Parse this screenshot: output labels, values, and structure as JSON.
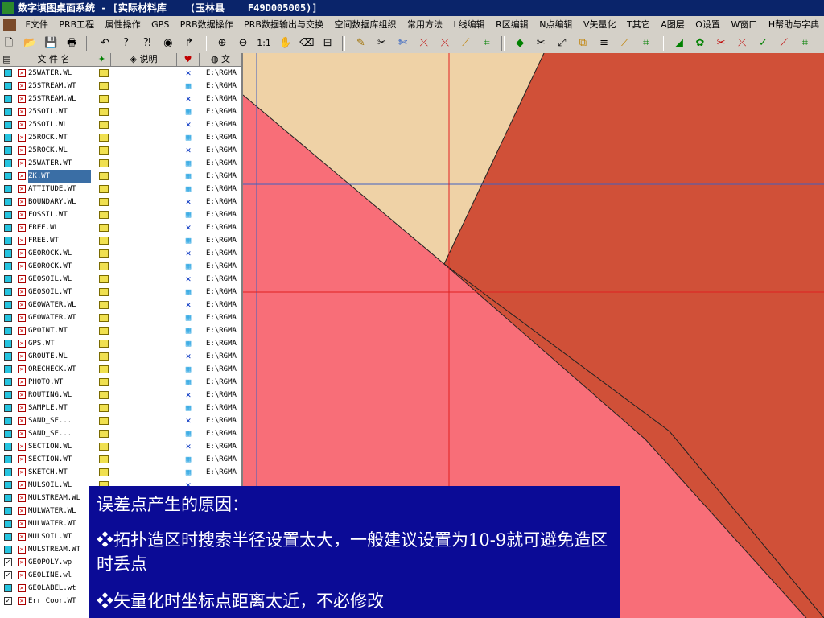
{
  "window": {
    "title": "数字填图桌面系统 - [实际材料库    (玉林县    F49D005005)]"
  },
  "menu": [
    {
      "label": "F文件"
    },
    {
      "label": "PRB工程"
    },
    {
      "label": "属性操作"
    },
    {
      "label": "GPS"
    },
    {
      "label": "PRB数据操作"
    },
    {
      "label": "PRB数据输出与交换"
    },
    {
      "label": "空间数据库组织"
    },
    {
      "label": "常用方法"
    },
    {
      "label": "L线编辑"
    },
    {
      "label": "R区编辑"
    },
    {
      "label": "N点编辑"
    },
    {
      "label": "V矢量化"
    },
    {
      "label": "T其它"
    },
    {
      "label": "A图层"
    },
    {
      "label": "O设置"
    },
    {
      "label": "W窗口"
    },
    {
      "label": "H帮助与字典"
    }
  ],
  "toolbar": {
    "zoom_label": "1:1"
  },
  "filelist": {
    "headers": {
      "name": "文 件 名",
      "desc": "说明",
      "path": "文"
    },
    "rows": [
      {
        "name": "25WATER.WL",
        "path": "E:\\RGMA",
        "checked": false,
        "type": "line"
      },
      {
        "name": "25STREAM.WT",
        "path": "E:\\RGMA",
        "checked": false,
        "type": "point"
      },
      {
        "name": "25STREAM.WL",
        "path": "E:\\RGMA",
        "checked": false,
        "type": "line"
      },
      {
        "name": "25SOIL.WT",
        "path": "E:\\RGMA",
        "checked": false,
        "type": "point"
      },
      {
        "name": "25SOIL.WL",
        "path": "E:\\RGMA",
        "checked": false,
        "type": "line"
      },
      {
        "name": "25ROCK.WT",
        "path": "E:\\RGMA",
        "checked": false,
        "type": "point"
      },
      {
        "name": "25ROCK.WL",
        "path": "E:\\RGMA",
        "checked": false,
        "type": "line"
      },
      {
        "name": "25WATER.WT",
        "path": "E:\\RGMA",
        "checked": false,
        "type": "point"
      },
      {
        "name": "ZK.WT",
        "path": "E:\\RGMA",
        "checked": false,
        "type": "point",
        "selected": true
      },
      {
        "name": "ATTITUDE.WT",
        "path": "E:\\RGMA",
        "checked": false,
        "type": "point"
      },
      {
        "name": "BOUNDARY.WL",
        "path": "E:\\RGMA",
        "checked": false,
        "type": "line"
      },
      {
        "name": "FOSSIL.WT",
        "path": "E:\\RGMA",
        "checked": false,
        "type": "point"
      },
      {
        "name": "FREE.WL",
        "path": "E:\\RGMA",
        "checked": false,
        "type": "line"
      },
      {
        "name": "FREE.WT",
        "path": "E:\\RGMA",
        "checked": false,
        "type": "point"
      },
      {
        "name": "GEOROCK.WL",
        "path": "E:\\RGMA",
        "checked": false,
        "type": "line"
      },
      {
        "name": "GEOROCK.WT",
        "path": "E:\\RGMA",
        "checked": false,
        "type": "point"
      },
      {
        "name": "GEOSOIL.WL",
        "path": "E:\\RGMA",
        "checked": false,
        "type": "line"
      },
      {
        "name": "GEOSOIL.WT",
        "path": "E:\\RGMA",
        "checked": false,
        "type": "point"
      },
      {
        "name": "GEOWATER.WL",
        "path": "E:\\RGMA",
        "checked": false,
        "type": "line"
      },
      {
        "name": "GEOWATER.WT",
        "path": "E:\\RGMA",
        "checked": false,
        "type": "point"
      },
      {
        "name": "GPOINT.WT",
        "path": "E:\\RGMA",
        "checked": false,
        "type": "point"
      },
      {
        "name": "GPS.WT",
        "path": "E:\\RGMA",
        "checked": false,
        "type": "point"
      },
      {
        "name": "GROUTE.WL",
        "path": "E:\\RGMA",
        "checked": false,
        "type": "line"
      },
      {
        "name": "ORECHECK.WT",
        "path": "E:\\RGMA",
        "checked": false,
        "type": "point"
      },
      {
        "name": "PHOTO.WT",
        "path": "E:\\RGMA",
        "checked": false,
        "type": "point"
      },
      {
        "name": "ROUTING.WL",
        "path": "E:\\RGMA",
        "checked": false,
        "type": "line"
      },
      {
        "name": "SAMPLE.WT",
        "path": "E:\\RGMA",
        "checked": false,
        "type": "point"
      },
      {
        "name": "SAND_SE...",
        "path": "E:\\RGMA",
        "checked": false,
        "type": "line"
      },
      {
        "name": "SAND_SE...",
        "path": "E:\\RGMA",
        "checked": false,
        "type": "point"
      },
      {
        "name": "SECTION.WL",
        "path": "E:\\RGMA",
        "checked": false,
        "type": "line"
      },
      {
        "name": "SECTION.WT",
        "path": "E:\\RGMA",
        "checked": false,
        "type": "point"
      },
      {
        "name": "SKETCH.WT",
        "path": "E:\\RGMA",
        "checked": false,
        "type": "point"
      },
      {
        "name": "MULSOIL.WL",
        "path": "",
        "checked": false,
        "type": "line"
      },
      {
        "name": "MULSTREAM.WL",
        "path": "",
        "checked": false,
        "type": "line"
      },
      {
        "name": "MULWATER.WL",
        "path": "",
        "checked": false,
        "type": "line"
      },
      {
        "name": "MULWATER.WT",
        "path": "",
        "checked": false,
        "type": "point"
      },
      {
        "name": "MULSOIL.WT",
        "path": "",
        "checked": false,
        "type": "point"
      },
      {
        "name": "MULSTREAM.WT",
        "path": "",
        "checked": false,
        "type": "point"
      },
      {
        "name": "GEOPOLY.wp",
        "path": "",
        "checked": true,
        "type": "area"
      },
      {
        "name": "GEOLINE.wl",
        "path": "",
        "checked": true,
        "type": "area"
      },
      {
        "name": "GEOLABEL.wt",
        "path": "",
        "checked": false,
        "type": "point"
      },
      {
        "name": "Err_Coor.WT",
        "path": "",
        "checked": true,
        "type": "area"
      }
    ]
  },
  "map": {
    "colors": {
      "polygon_tan": "#efd2a6",
      "polygon_pink": "#f86e78",
      "polygon_brown": "#d05038",
      "crosshair_red": "#e02020",
      "crosshair_blue": "#4060c0"
    }
  },
  "overlay": {
    "heading": "误差点产生的原因：",
    "bullet1": "❖拓扑造区时搜索半径设置太大，一般建议设置为10-9就可避免造区时丢点",
    "bullet2": "❖矢量化时坐标点距离太近，不必修改"
  }
}
